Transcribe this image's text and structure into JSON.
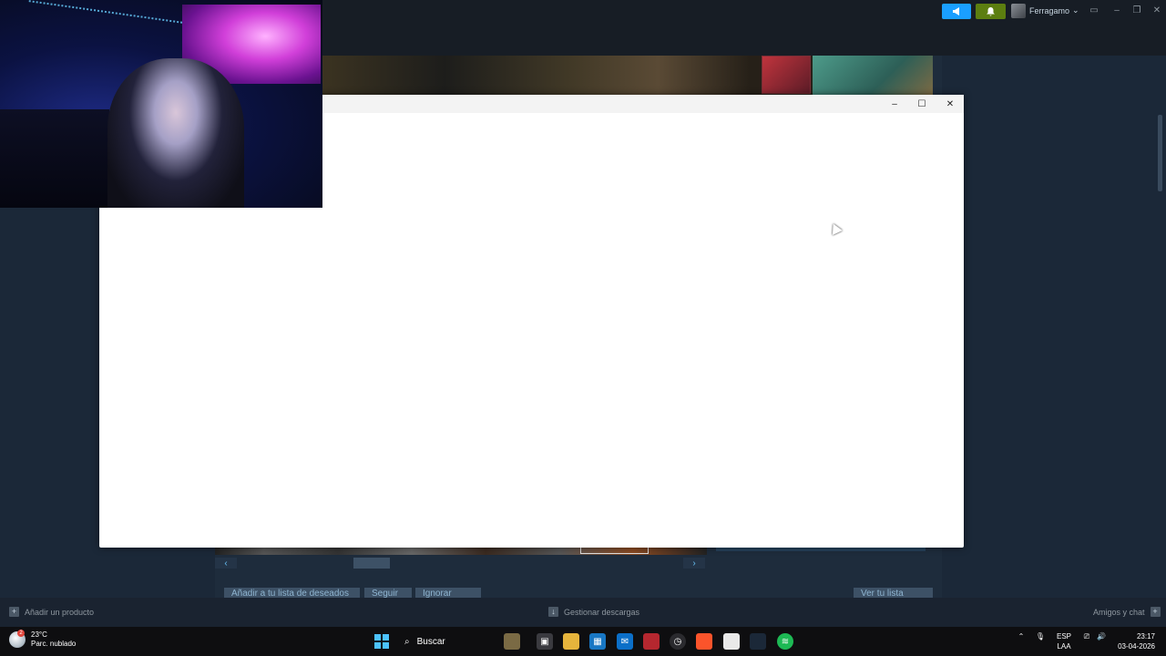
{
  "steam": {
    "username": "Ferragamo",
    "username_caret": "⌄",
    "footer": {
      "add_product": "Añadir un producto",
      "manage_downloads": "Gestionar descargas",
      "friends_chat": "Amigos y chat"
    },
    "store": {
      "wishlist_button": "Añadir a tu lista de deseados",
      "follow_button": "Seguir",
      "ignore_button": "Ignorar",
      "view_queue_button": "Ver tu lista"
    }
  },
  "icons": {
    "announce": "megaphone-icon",
    "notify": "bell-icon",
    "modal_minimize": "minimize-icon",
    "modal_maximize": "maximize-icon",
    "modal_close": "close-icon"
  },
  "colors": {
    "steam_bg": "#1b2838",
    "steam_header": "#171d25",
    "announce_blue": "#1a9fff",
    "notify_green": "#5c7e10",
    "windows_accent": "#4cc2ff"
  },
  "taskbar": {
    "weather_temp": "23°C",
    "weather_desc": "Parc. nublado",
    "weather_badge": "2",
    "search_label": "Buscar",
    "lang_top": "ESP",
    "lang_bottom": "LAA",
    "time": "23:17",
    "date": "03-04-2026"
  }
}
